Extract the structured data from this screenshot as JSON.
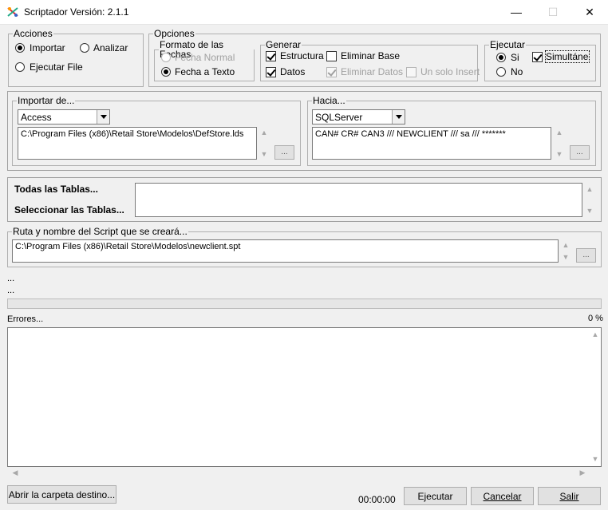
{
  "window": {
    "title": "Scriptador Versión: 2.1.1",
    "minimize": "—",
    "maximize": "☐",
    "close": "✕"
  },
  "acciones": {
    "legend": "Acciones",
    "importar": "Importar",
    "analizar": "Analizar",
    "ejecutar_file": "Ejecutar File",
    "selected": "importar"
  },
  "opciones": {
    "legend": "Opciones",
    "formato": {
      "legend": "Formato de las Fechas",
      "fecha_normal": "Fecha Normal",
      "fecha_texto": "Fecha a Texto",
      "selected": "fecha_texto"
    },
    "generar": {
      "legend": "Generar",
      "estructura": "Estructura",
      "estructura_checked": true,
      "eliminar_base": "Eliminar Base",
      "eliminar_base_checked": false,
      "datos": "Datos",
      "datos_checked": true,
      "eliminar_datos": "Eliminar Datos",
      "eliminar_datos_checked": true,
      "un_solo_insert": "Un solo Insert",
      "un_solo_insert_checked": false
    },
    "ejecutar": {
      "legend": "Ejecutar",
      "si": "Si",
      "no": "No",
      "selected": "si",
      "simultaneo": "Simultánec",
      "simultaneo_checked": true
    }
  },
  "importar_de": {
    "legend": "Importar de...",
    "source": "Access",
    "path": "C:\\Program Files (x86)\\Retail Store\\Modelos\\DefStore.lds",
    "browse": "..."
  },
  "hacia": {
    "legend": "Hacia...",
    "target": "SQLServer",
    "connection": "CAN# CR# CAN3 /// NEWCLIENT /// sa /// *******",
    "browse": "..."
  },
  "tablas": {
    "todas": "Todas las Tablas...",
    "seleccionar": "Seleccionar las Tablas..."
  },
  "ruta": {
    "legend": "Ruta y nombre del Script que se creará...",
    "path": "C:\\Program Files (x86)\\Retail Store\\Modelos\\newclient.spt",
    "browse": "..."
  },
  "status": {
    "line1": "...",
    "line2": "...",
    "errores": "Errores...",
    "percent": "0 %",
    "progress": 0
  },
  "footer": {
    "abrir_carpeta": "Abrir la carpeta destino...",
    "time": "00:00:00",
    "ejecutar": "Ejecutar",
    "cancelar": "Cancelar",
    "salir": "Salir"
  }
}
